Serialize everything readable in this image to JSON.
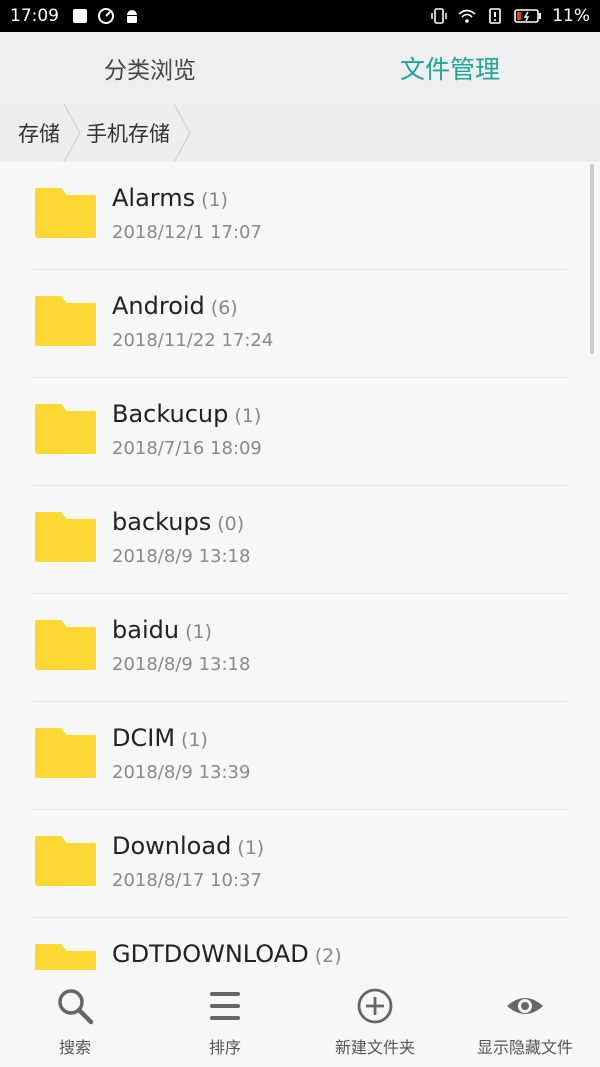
{
  "status_bar": {
    "time": "17:09",
    "battery": "11%",
    "icons": [
      "notification-square-icon",
      "speedometer-icon",
      "android-icon",
      "vibrate-icon",
      "wifi-icon",
      "alert-icon",
      "battery-icon"
    ]
  },
  "tabs": [
    {
      "label": "分类浏览",
      "active": false
    },
    {
      "label": "文件管理",
      "active": true
    }
  ],
  "breadcrumb": [
    "存储",
    "手机存储"
  ],
  "colors": {
    "accent": "#1aa89a",
    "folder": "#fdd835"
  },
  "files": [
    {
      "name": "Alarms",
      "count": "(1)",
      "date": "2018/12/1 17:07"
    },
    {
      "name": "Android",
      "count": "(6)",
      "date": "2018/11/22 17:24"
    },
    {
      "name": "Backucup",
      "count": "(1)",
      "date": "2018/7/16 18:09"
    },
    {
      "name": "backups",
      "count": "(0)",
      "date": "2018/8/9 13:18"
    },
    {
      "name": "baidu",
      "count": "(1)",
      "date": "2018/8/9 13:18"
    },
    {
      "name": "DCIM",
      "count": "(1)",
      "date": "2018/8/9 13:39"
    },
    {
      "name": "Download",
      "count": "(1)",
      "date": "2018/8/17 10:37"
    },
    {
      "name": "GDTDOWNLOAD",
      "count": "(2)",
      "date": ""
    }
  ],
  "toolbar": {
    "search": "搜索",
    "sort": "排序",
    "new_folder": "新建文件夹",
    "show_hidden": "显示隐藏文件"
  }
}
